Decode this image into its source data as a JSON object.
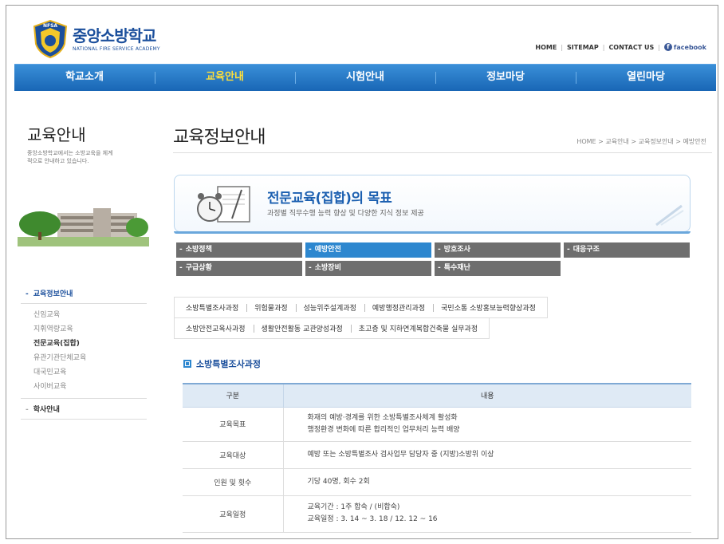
{
  "header": {
    "logo_kr": "중앙소방학교",
    "logo_en": "NATIONAL FIRE SERVICE ACADEMY",
    "emblem_text": "NFSA",
    "util_links": [
      "HOME",
      "SITEMAP",
      "CONTACT US"
    ],
    "facebook": "facebook"
  },
  "gnb": [
    "학교소개",
    "교육안내",
    "시험안내",
    "정보마당",
    "열린마당"
  ],
  "lnb": {
    "title": "교육안내",
    "desc": "중앙소방학교에서는 소방교육을 체계적으로 안내하고 있습니다.",
    "head": "교육정보안내",
    "subs": [
      "신임교육",
      "지휘역량교육",
      "전문교육(집합)",
      "유관기관단체교육",
      "대국민교육",
      "사이버교육"
    ],
    "head2": "학사안내"
  },
  "content": {
    "title": "교육정보안내",
    "breadcrumb": "HOME > 교육안내 > 교육정보안내 > 예방안전",
    "goal_title": "전문교육(집합)의 목표",
    "goal_sub": "과정별 직무수행 능력 향상 및 다양한 지식 정보 제공",
    "categories": [
      "소방정책",
      "예방안전",
      "방호조사",
      "대응구조",
      "구급상황",
      "소방장비",
      "특수재난"
    ],
    "courses_row1": [
      "소방특별조사과정",
      "위험물과정",
      "성능위주설계과정",
      "예방행정관리과정",
      "국민소통 소방홍보능력향상과정"
    ],
    "courses_row2": [
      "소방안전교육사과정",
      "생활안전활동 교관양성과정",
      "초고층 및 지하연계복합건축물 실무과정"
    ],
    "section_title": "소방특별조사과정",
    "table": {
      "headers": [
        "구분",
        "내용"
      ],
      "rows": [
        {
          "k": "교육목표",
          "v1": "화재의 예방·경계를 위한 소방특별조사체계 활성화",
          "v2": "행정환경 변화에 따른 합리적인 업무처리 능력 배양"
        },
        {
          "k": "교육대상",
          "v1": "예방 또는 소방특별조사 검사업무 담당자 중 (지방)소방위 이상",
          "v2": ""
        },
        {
          "k": "인원 및 횟수",
          "v1": "기당 40명, 회수 2회",
          "v2": ""
        },
        {
          "k": "교육일정",
          "v1": "교육기간 : 1주 합숙 / (비합숙)",
          "v2": "교육일정 : 3. 14 ~ 3. 18 / 12. 12 ~ 16"
        }
      ]
    }
  },
  "colors": {
    "brand_blue": "#1b4f9c",
    "nav_blue": "#1966b5",
    "active_cat": "#2d87cf",
    "nav_active_text": "#ffdf3a"
  }
}
